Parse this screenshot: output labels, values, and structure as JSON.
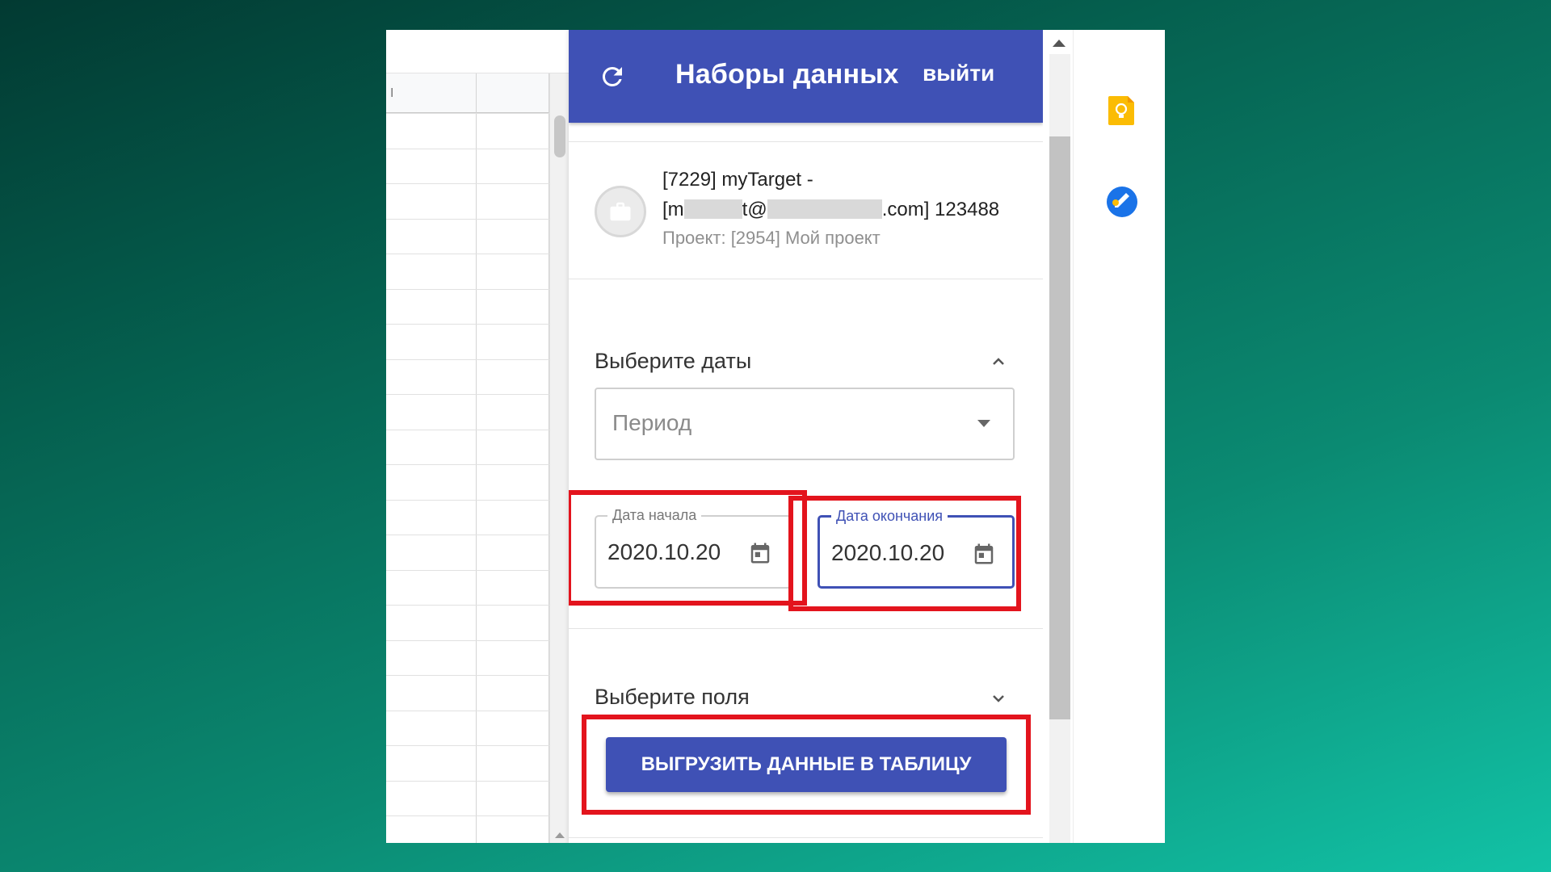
{
  "sheet": {
    "column_marker": "I"
  },
  "panel": {
    "title": "Наборы данных",
    "logout_label": "выйти",
    "header_color": "#3f51b5"
  },
  "account": {
    "line1": "[7229] myTarget -",
    "line2_start": "[m",
    "line2_mid": "t@",
    "line2_end": ".com] 123488",
    "project": "Проект: [2954] Мой проект"
  },
  "dates": {
    "section_label": "Выберите даты",
    "period_placeholder": "Период",
    "start_label": "Дата начала",
    "start_value": "2020.10.20",
    "end_label": "Дата окончания",
    "end_value": "2020.10.20"
  },
  "fields": {
    "section_label": "Выберите поля"
  },
  "export_button": "ВЫГРУЗИТЬ ДАННЫЕ В ТАБЛИЦУ",
  "highlight_color": "#e3141d",
  "side_icons": [
    "keep-icon",
    "tasks-icon"
  ]
}
